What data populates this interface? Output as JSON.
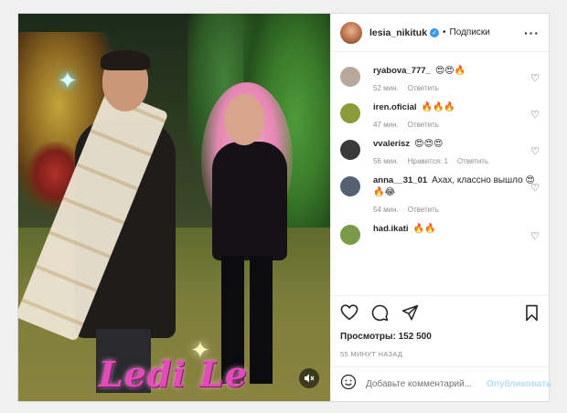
{
  "post": {
    "watermark": "Ledi Le",
    "mute_icon": "speaker-muted-icon"
  },
  "header": {
    "username": "lesia_nikituk",
    "verified_icon": "verified-badge-icon",
    "separator": "•",
    "follow_label": "Подписки",
    "more_icon": "more-dots-icon"
  },
  "comments": [
    {
      "user": "ryabova_777_",
      "text": "😍😍🔥",
      "time": "52 мин.",
      "likes": "",
      "reply": "Ответить",
      "avatar_color": "#b8a89c"
    },
    {
      "user": "iren.oficial",
      "text": "🔥🔥🔥",
      "time": "47 мин.",
      "likes": "",
      "reply": "Ответить",
      "avatar_color": "#8c9a3a"
    },
    {
      "user": "vvalerisz",
      "text": "😍😍😍",
      "time": "56 мин.",
      "likes": "Нравится: 1",
      "reply": "Ответить",
      "avatar_color": "#3a3a3a"
    },
    {
      "user": "anna__31_01",
      "text": "Ахах, классно вышло 😍🔥😂",
      "time": "54 мин.",
      "likes": "",
      "reply": "Ответить",
      "avatar_color": "#556070"
    },
    {
      "user": "had.ikati",
      "text": "🔥🔥",
      "time": "",
      "likes": "",
      "reply": "",
      "avatar_color": "#7a9a4a"
    }
  ],
  "actions": {
    "like_icon": "heart-icon",
    "comment_icon": "comment-bubble-icon",
    "share_icon": "paper-plane-icon",
    "save_icon": "bookmark-icon"
  },
  "views_label": "Просмотры: 152 500",
  "time_ago": "55 МИНУТ НАЗАД",
  "add_comment": {
    "emoji_icon": "smile-icon",
    "placeholder": "Добавьте комментарий...",
    "publish_label": "Опубликовать"
  }
}
